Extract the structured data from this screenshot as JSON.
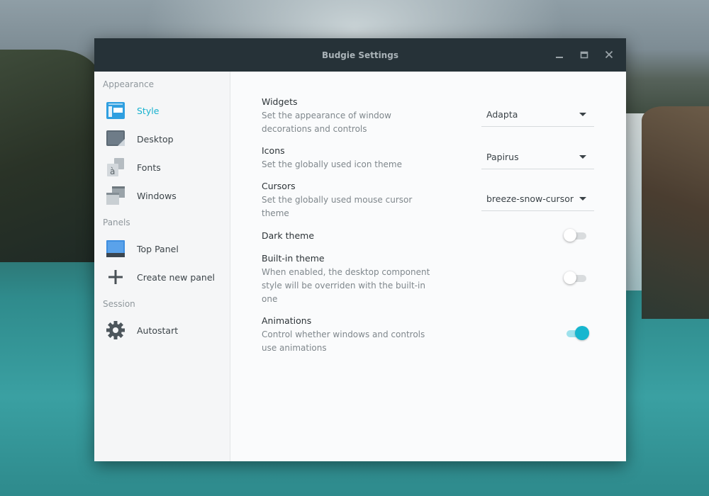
{
  "window": {
    "title": "Budgie Settings"
  },
  "sidebar": {
    "sections": [
      {
        "label": "Appearance"
      },
      {
        "label": "Panels"
      },
      {
        "label": "Session"
      }
    ],
    "items": [
      {
        "label": "Style",
        "icon": "style-icon",
        "active": true
      },
      {
        "label": "Desktop",
        "icon": "desktop-icon"
      },
      {
        "label": "Fonts",
        "icon": "fonts-icon"
      },
      {
        "label": "Windows",
        "icon": "windows-icon"
      },
      {
        "label": "Top Panel",
        "icon": "top-panel-icon"
      },
      {
        "label": "Create new panel",
        "icon": "plus-icon"
      },
      {
        "label": "Autostart",
        "icon": "gear-icon"
      }
    ]
  },
  "options": {
    "widgets": {
      "title": "Widgets",
      "description": "Set the appearance of window decorations and controls",
      "value": "Adapta"
    },
    "icons": {
      "title": "Icons",
      "description": "Set the globally used icon theme",
      "value": "Papirus"
    },
    "cursors": {
      "title": "Cursors",
      "description": "Set the globally used mouse cursor theme",
      "value": "breeze-snow-cursor"
    },
    "dark_theme": {
      "title": "Dark theme",
      "enabled": false
    },
    "builtin_theme": {
      "title": "Built-in theme",
      "description": "When enabled, the desktop component style will be overriden with the built-in one",
      "enabled": false
    },
    "animations": {
      "title": "Animations",
      "description": "Control whether windows and controls use animations",
      "enabled": true
    }
  },
  "colors": {
    "accent": "#16b6cf",
    "titlebar": "#263238",
    "sidebar": "#f5f6f7"
  }
}
